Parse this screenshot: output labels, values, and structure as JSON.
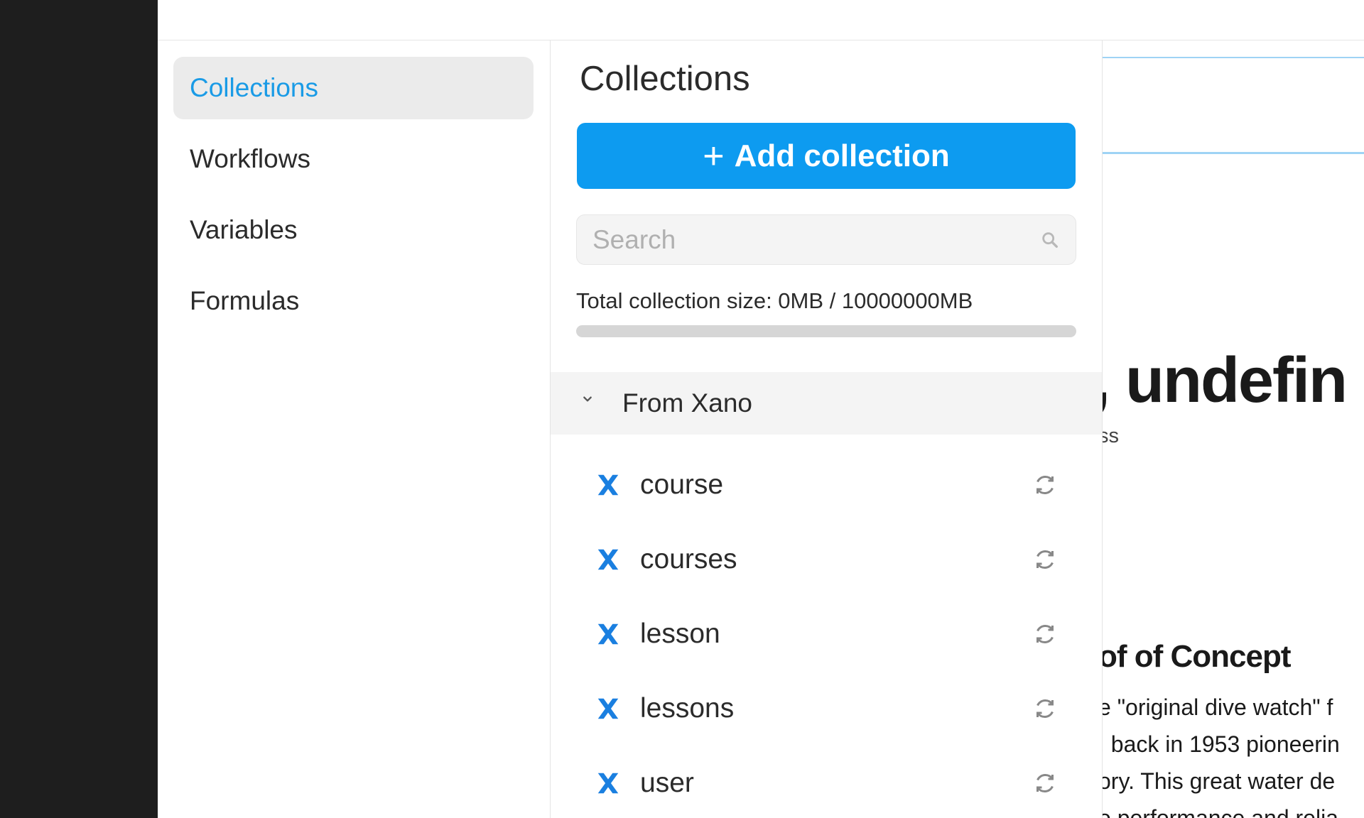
{
  "sidebar": {
    "items": [
      {
        "label": "Collections",
        "active": true
      },
      {
        "label": "Workflows",
        "active": false
      },
      {
        "label": "Variables",
        "active": false
      },
      {
        "label": "Formulas",
        "active": false
      }
    ]
  },
  "panel": {
    "title": "Collections",
    "add_button": {
      "icon": "+",
      "label": "Add collection"
    },
    "search": {
      "placeholder": "Search",
      "value": ""
    },
    "size_text": "Total collection size: 0MB / 10000000MB",
    "size_progress_fraction": 0,
    "group": {
      "label": "From Xano",
      "expanded": true,
      "items": [
        {
          "name": "course"
        },
        {
          "name": "courses"
        },
        {
          "name": "lesson"
        },
        {
          "name": "lessons"
        },
        {
          "name": "user"
        }
      ]
    }
  },
  "preview": {
    "headline": ", undefin",
    "subtext": "ss",
    "section_heading": "of of Concept",
    "paragraph_lines": [
      "e \"original dive watch\" f",
      ", back in 1953 pioneerin",
      "ory. This great water de",
      "o performance and relia"
    ]
  },
  "colors": {
    "accent": "#0d9bf0",
    "active_nav_text": "#1a9be6",
    "xano_icon": "#1a7fe0"
  }
}
